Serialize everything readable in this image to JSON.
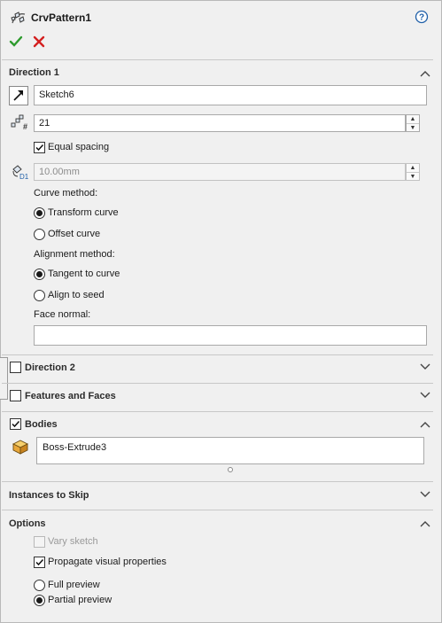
{
  "header": {
    "title": "CrvPattern1",
    "help_icon": "help-circle-icon",
    "ok_icon": "green-check-icon",
    "cancel_icon": "red-x-icon"
  },
  "direction1": {
    "title": "Direction 1",
    "reference_value": "Sketch6",
    "instances_value": "21",
    "equal_spacing_label": "Equal spacing",
    "spacing_value": "10.00mm",
    "curve_method_label": "Curve method:",
    "transform_curve_label": "Transform curve",
    "offset_curve_label": "Offset curve",
    "alignment_method_label": "Alignment method:",
    "tangent_label": "Tangent to curve",
    "align_seed_label": "Align to seed",
    "face_normal_label": "Face normal:",
    "face_normal_value": ""
  },
  "direction2": {
    "title": "Direction 2"
  },
  "features_faces": {
    "title": "Features and Faces"
  },
  "bodies": {
    "title": "Bodies",
    "item": "Boss-Extrude3"
  },
  "instances_to_skip": {
    "title": "Instances to Skip"
  },
  "options": {
    "title": "Options",
    "vary_sketch_label": "Vary sketch",
    "propagate_label": "Propagate visual properties",
    "full_preview_label": "Full preview",
    "partial_preview_label": "Partial preview"
  },
  "colors": {
    "ok": "#2e9b2e",
    "cancel": "#d42020",
    "help": "#1f5fa8",
    "body_icon": "#e8a73a"
  }
}
